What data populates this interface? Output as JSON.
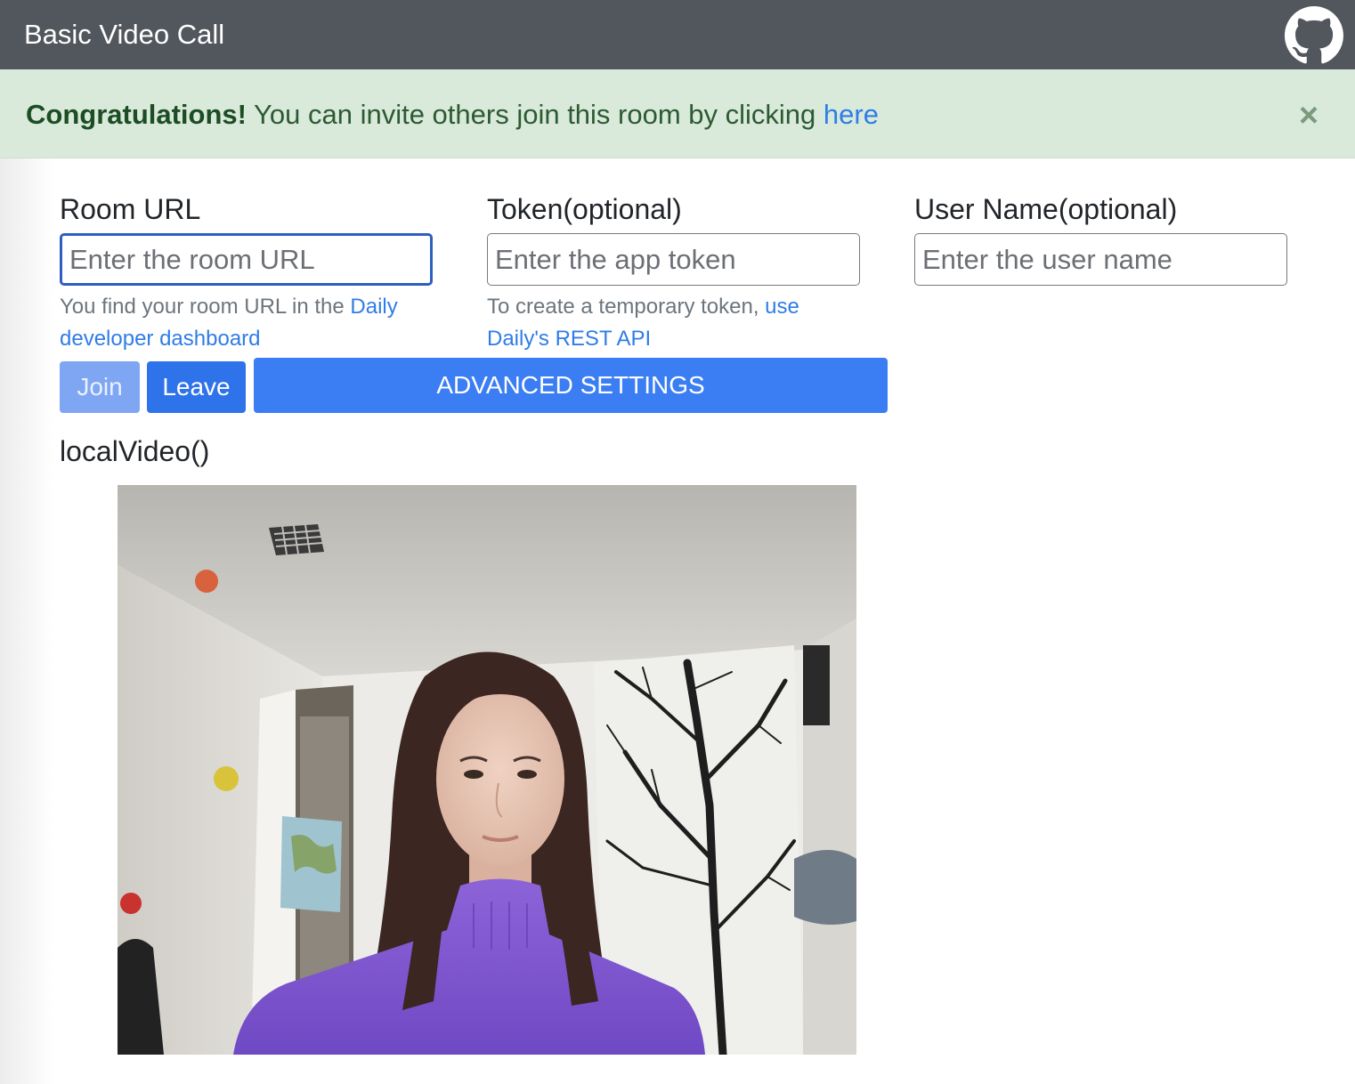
{
  "navbar": {
    "title": "Basic Video Call",
    "github_icon": "github-icon"
  },
  "alert": {
    "strong": "Congratulations!",
    "text": " You can invite others join this room by clicking ",
    "link": "here",
    "close": "×"
  },
  "form": {
    "room_url": {
      "label": "Room URL",
      "placeholder": "Enter the room URL",
      "help_text": "You find your room URL in the ",
      "help_link": "Daily developer dashboard"
    },
    "token": {
      "label": "Token(optional)",
      "placeholder": "Enter the app token",
      "help_text": "To create a temporary token, ",
      "help_link": "use Daily's REST API"
    },
    "user_name": {
      "label": "User Name(optional)",
      "placeholder": "Enter the user name"
    }
  },
  "buttons": {
    "join": "Join",
    "leave": "Leave",
    "advanced": "ADVANCED SETTINGS"
  },
  "video": {
    "label": "localVideo()"
  },
  "colors": {
    "navbar": "#52565d",
    "alert_bg": "#d9eadb",
    "primary": "#3b7df2",
    "link": "#2f7de6"
  }
}
